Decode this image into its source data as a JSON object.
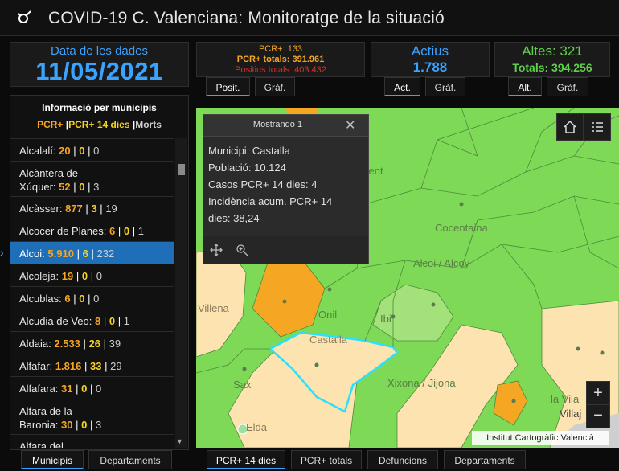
{
  "header": {
    "title": "COVID-19 C. Valenciana: Monitoratge de la situació",
    "logo_icon": "virus-logo-icon"
  },
  "date_panel": {
    "label": "Data de les dades",
    "value": "11/05/2021"
  },
  "pcr_panel": {
    "line1": "PCR+: 133",
    "line2": "PCR+ totals: 391.961",
    "line3": "Positius totals: 403.432",
    "tabs": [
      "Posit.",
      "Gràf."
    ]
  },
  "active_panel": {
    "label": "Actius",
    "value": "1.788",
    "tabs": [
      "Act.",
      "Gràf."
    ]
  },
  "altes_panel": {
    "line1": "Altes: 321",
    "line2": "Totals: 394.256",
    "tabs": [
      "Alt.",
      "Gràf."
    ]
  },
  "list": {
    "title": "Informació per municipis",
    "legend": {
      "pcr": "PCR+",
      "pcr14": "PCR+ 14 dies",
      "morts": "Morts",
      "sep": "|"
    },
    "rows": [
      {
        "name": "Alcalalí:",
        "pcr": "20",
        "pcr14": "0",
        "morts": "0"
      },
      {
        "name": "Alcàntera de",
        "name2": "Xúquer:",
        "pcr": "52",
        "pcr14": "0",
        "morts": "3"
      },
      {
        "name": "Alcàsser:",
        "pcr": "877",
        "pcr14": "3",
        "morts": "19"
      },
      {
        "name": "Alcocer de Planes:",
        "pcr": "6",
        "pcr14": "0",
        "morts": "1"
      },
      {
        "name": "Alcoi:",
        "pcr": "5.910",
        "pcr14": "6",
        "morts": "232"
      },
      {
        "name": "Alcoleja:",
        "pcr": "19",
        "pcr14": "0",
        "morts": "0"
      },
      {
        "name": "Alcublas:",
        "pcr": "6",
        "pcr14": "0",
        "morts": "0"
      },
      {
        "name": "Alcudia de Veo:",
        "pcr": "8",
        "pcr14": "0",
        "morts": "1"
      },
      {
        "name": "Aldaia:",
        "pcr": "2.533",
        "pcr14": "26",
        "morts": "39"
      },
      {
        "name": "Alfafar:",
        "pcr": "1.816",
        "pcr14": "33",
        "morts": "29"
      },
      {
        "name": "Alfafara:",
        "pcr": "31",
        "pcr14": "0",
        "morts": "0"
      },
      {
        "name": "Alfara de la",
        "name2": "Baronia:",
        "pcr": "30",
        "pcr14": "0",
        "morts": "3"
      },
      {
        "name": "Alfara del",
        "name2": "",
        "pcr": "",
        "pcr14": "",
        "morts": ""
      }
    ]
  },
  "left_tabs": [
    "Municipis",
    "Departaments"
  ],
  "map_tabs": [
    "PCR+ 14 dies",
    "PCR+ totals",
    "Defuncions",
    "Departaments"
  ],
  "popup": {
    "title": "Mostrando 1",
    "lines": [
      "Municipi: Castalla",
      "Població: 10.124",
      "Casos PCR+ 14 dies: 4",
      "Incidència acum. PCR+ 14",
      "dies: 38,24"
    ]
  },
  "map_labels": [
    "Cocentaina",
    "Alcoi / Alcoy",
    "Villena",
    "Onil",
    "Ibi",
    "Castalla",
    "Sax",
    "Xixona / Jijona",
    "Elda",
    "la Vila",
    "Villaj",
    "yent"
  ],
  "map_controls": {
    "zoom_in": "+",
    "zoom_out": "−"
  },
  "attribution": "Institut Cartogràfic Valencià",
  "colors": {
    "accent": "#3aa3ff",
    "pcr": "#f5a623",
    "green": "#5fd04a",
    "low": "#fde3b0",
    "high": "#f5a623",
    "map_green": "#7ed957"
  }
}
